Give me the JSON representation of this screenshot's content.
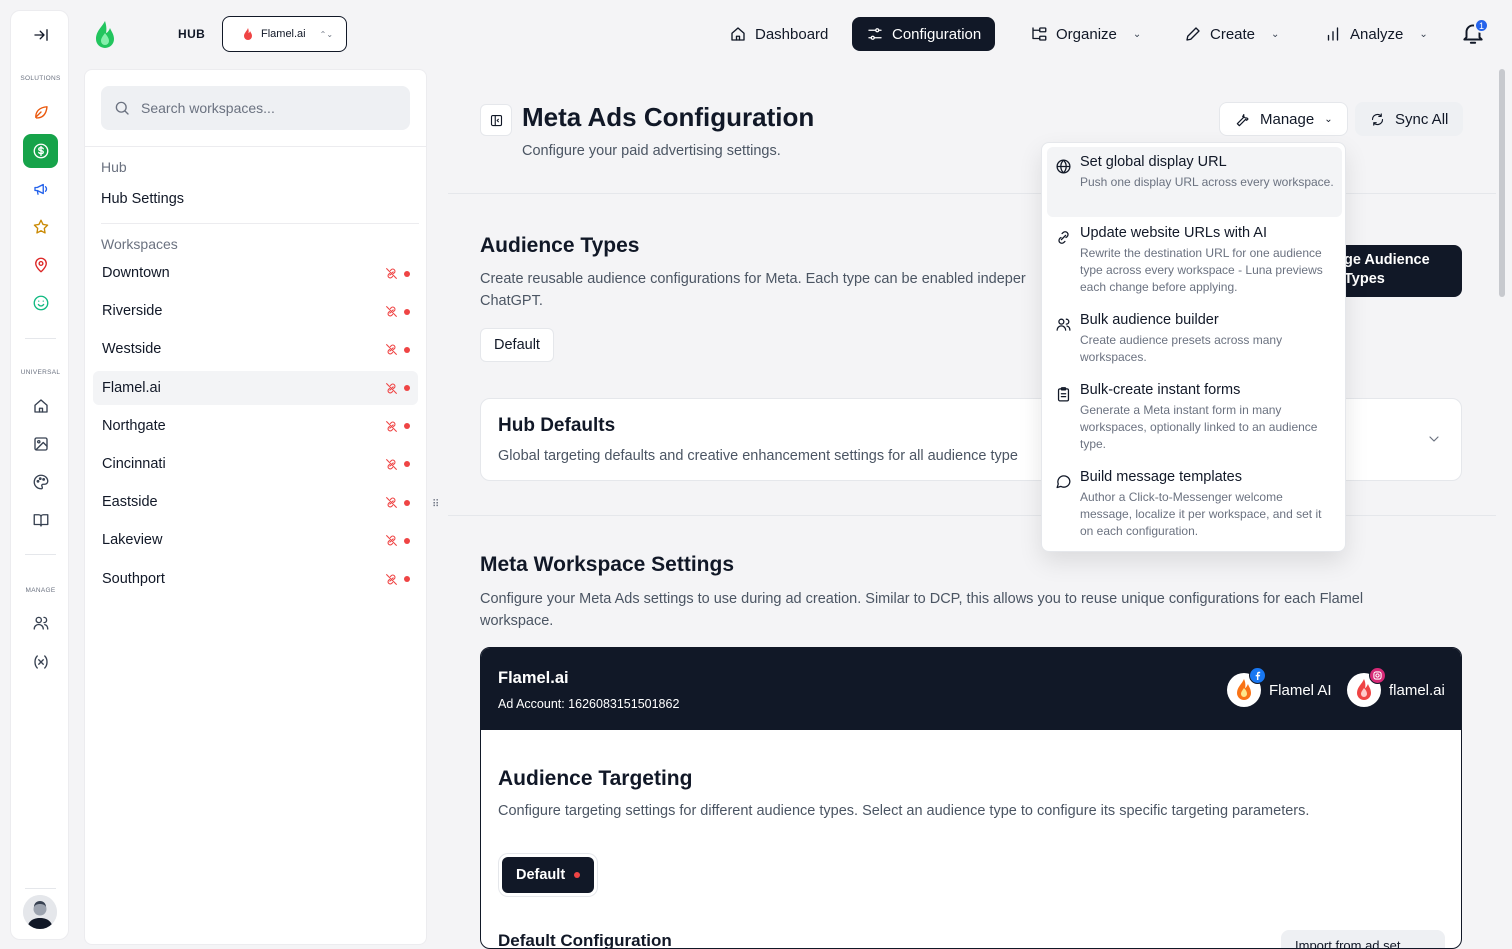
{
  "rail": {
    "solutions_label": "SOLUTIONS",
    "universal_label": "UNIVERSAL",
    "manage_label": "MANAGE"
  },
  "topbar": {
    "hub_label": "HUB",
    "workspace": "Flamel.ai",
    "nav": {
      "dashboard": "Dashboard",
      "configuration": "Configuration",
      "organize": "Organize",
      "create": "Create",
      "analyze": "Analyze"
    },
    "notifications": "1"
  },
  "sidebar": {
    "search_placeholder": "Search workspaces...",
    "hub_section": "Hub",
    "hub_settings": "Hub Settings",
    "workspaces_section": "Workspaces",
    "workspaces": [
      "Downtown",
      "Riverside",
      "Westside",
      "Flamel.ai",
      "Northgate",
      "Cincinnati",
      "Eastside",
      "Lakeview",
      "Southport"
    ],
    "active_workspace": "Flamel.ai"
  },
  "page": {
    "title": "Meta Ads Configuration",
    "subtitle": "Configure your paid advertising settings.",
    "manage_label": "Manage",
    "sync_label": "Sync All"
  },
  "audience_types": {
    "title": "Audience Types",
    "description_line1": "Create reusable audience configurations for Meta. Each type can be enabled indeper",
    "description_line2": "ChatGPT.",
    "chip": "Default",
    "manage_button_line1": "ge Audience",
    "manage_button_line2": "Types"
  },
  "hub_defaults": {
    "title": "Hub Defaults",
    "description": "Global targeting defaults and creative enhancement settings for all audience type"
  },
  "meta_ws": {
    "title": "Meta Workspace Settings",
    "description_line1": "Configure your Meta Ads settings to use during ad creation. Similar to DCP, this allows you to reuse unique configurations for each Flamel",
    "description_line2": "workspace."
  },
  "card": {
    "name": "Flamel.ai",
    "ad_account": "Ad Account: 1626083151501862",
    "accounts": [
      {
        "name": "Flamel AI",
        "platform": "facebook"
      },
      {
        "name": "flamel.ai",
        "platform": "instagram"
      }
    ],
    "targeting_title": "Audience Targeting",
    "targeting_desc": "Configure targeting settings for different audience types. Select an audience type to configure its specific targeting parameters.",
    "default_btn": "Default",
    "default_config": "Default Configuration",
    "import_btn": "Import from ad set"
  },
  "menu": {
    "items": [
      {
        "title": "Set global display URL",
        "desc": "Push one display URL across every workspace.",
        "icon": "globe-icon"
      },
      {
        "title": "Update website URLs with AI",
        "desc": "Rewrite the destination URL for one audience type across every workspace - Luna previews each change before applying.",
        "icon": "link-icon"
      },
      {
        "title": "Bulk audience builder",
        "desc": "Create audience presets across many workspaces.",
        "icon": "users-icon"
      },
      {
        "title": "Bulk-create instant forms",
        "desc": "Generate a Meta instant form in many workspaces, optionally linked to an audience type.",
        "icon": "clipboard-icon"
      },
      {
        "title": "Build message templates",
        "desc": "Author a Click-to-Messenger welcome message, localize it per workspace, and set it on each configuration.",
        "icon": "message-circle-icon"
      }
    ]
  },
  "colors": {
    "accent_green": "#16a34a",
    "dark": "#111827",
    "status_red": "#ef4444",
    "badge_blue": "#2563eb"
  }
}
